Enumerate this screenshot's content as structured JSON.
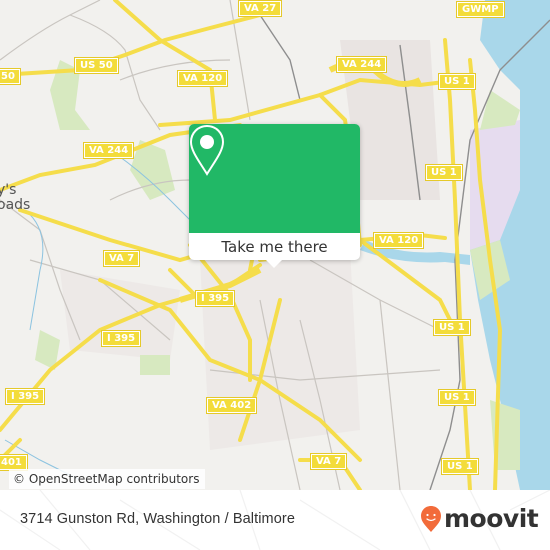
{
  "map": {
    "road_shields": [
      {
        "id": "va27",
        "label": "VA 27"
      },
      {
        "id": "gwmp",
        "label": "GWMP"
      },
      {
        "id": "us50a",
        "label": "50"
      },
      {
        "id": "us50b",
        "label": "US 50"
      },
      {
        "id": "va120a",
        "label": "VA 120"
      },
      {
        "id": "va244a",
        "label": "VA 244"
      },
      {
        "id": "us1a",
        "label": "US 1"
      },
      {
        "id": "va244b",
        "label": "VA 244"
      },
      {
        "id": "us1b",
        "label": "US 1"
      },
      {
        "id": "va7a",
        "label": "VA 7"
      },
      {
        "id": "va120b",
        "label": "VA 120"
      },
      {
        "id": "i395a",
        "label": "I 395"
      },
      {
        "id": "i395b",
        "label": "I 395"
      },
      {
        "id": "i395c",
        "label": "I 395"
      },
      {
        "id": "us1c",
        "label": "US 1"
      },
      {
        "id": "va402",
        "label": "VA 402"
      },
      {
        "id": "us1d",
        "label": "US 1"
      },
      {
        "id": "va7b",
        "label": "VA 7"
      },
      {
        "id": "us1e",
        "label": "US 1"
      },
      {
        "id": "rt401",
        "label": "401"
      }
    ],
    "place_label": {
      "line1": "y's",
      "line2": "oads"
    },
    "colors": {
      "road": "#f5dd4b",
      "water": "#a9d7ea",
      "park": "#d7e9c0",
      "airport": "#e6dcef",
      "land": "#f2f1ee"
    }
  },
  "popup": {
    "icon": "map-pin-icon",
    "button_label": "Take me there",
    "color": "#21b866"
  },
  "attribution": "© OpenStreetMap contributors",
  "footer": {
    "address": "3714 Gunston Rd, Washington / Baltimore",
    "brand": "moovit",
    "brand_color": "#f26b3a"
  }
}
